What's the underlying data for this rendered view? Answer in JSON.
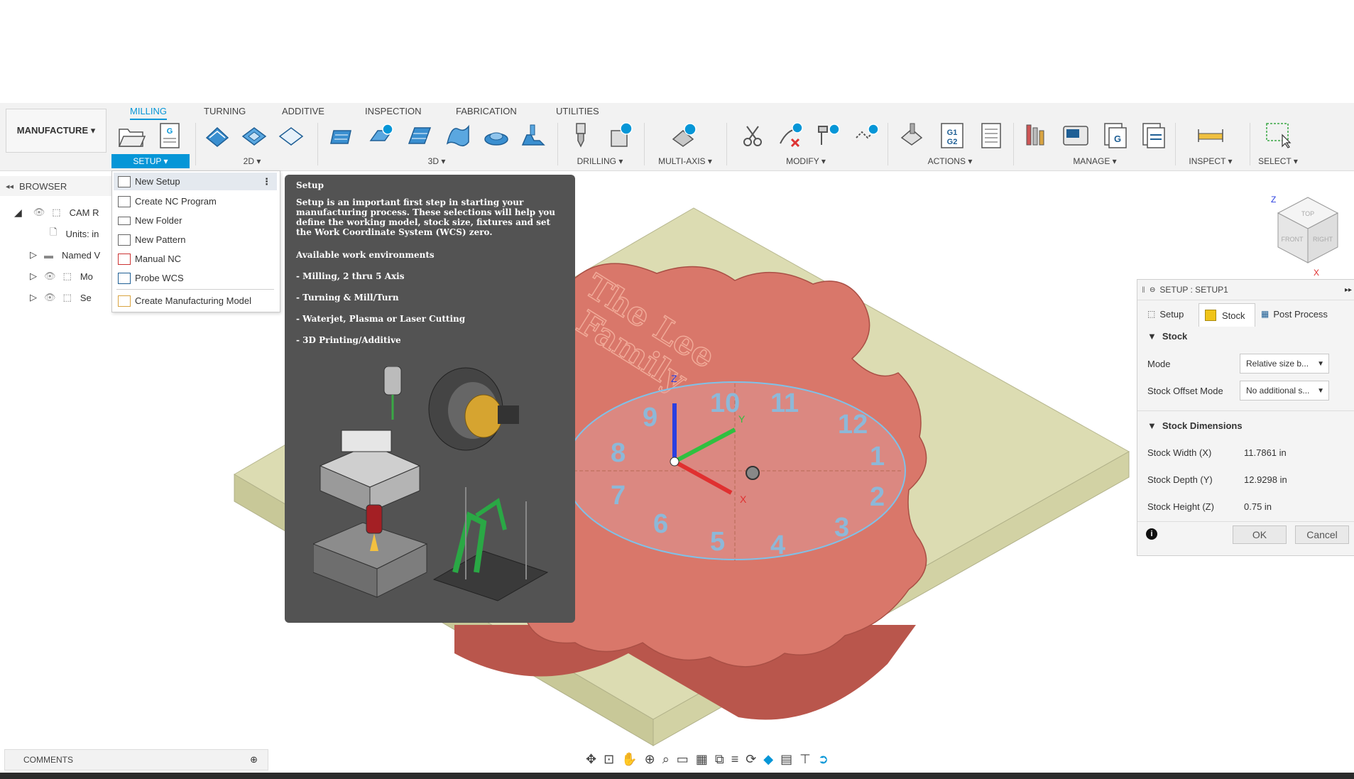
{
  "workspace": {
    "label": "MANUFACTURE ▾"
  },
  "tabs": [
    "MILLING",
    "TURNING",
    "ADDITIVE",
    "INSPECTION",
    "FABRICATION",
    "UTILITIES"
  ],
  "toolbar_groups": {
    "setup": "SETUP ▾",
    "twod": "2D ▾",
    "threed": "3D ▾",
    "drilling": "DRILLING ▾",
    "multiaxis": "MULTI-AXIS ▾",
    "modify": "MODIFY ▾",
    "actions": "ACTIONS ▾",
    "manage": "MANAGE ▾",
    "inspect": "INSPECT ▾",
    "select": "SELECT ▾"
  },
  "browser": {
    "header": "BROWSER",
    "rows": [
      "CAM R",
      "Units: in",
      "Named V",
      "Mo",
      "Se"
    ]
  },
  "setup_menu": {
    "items": [
      "New Setup",
      "Create NC Program",
      "New Folder",
      "New Pattern",
      "Manual NC",
      "Probe WCS",
      "Create Manufacturing Model"
    ]
  },
  "tooltip": {
    "title": "Setup",
    "description": "Setup is an important first step in starting your manufacturing process. These selections will help you define the working model, stock size, fixtures and set the Work Coordinate System (WCS) zero.",
    "environments_heading": "Available work environments",
    "environments": [
      "- Milling, 2 thru 5 Axis",
      "- Turning & Mill/Turn",
      "- Waterjet, Plasma or Laser Cutting",
      "- 3D Printing/Additive"
    ]
  },
  "viewport": {
    "engraving": [
      "The Lee",
      "Family"
    ],
    "clock_numbers": [
      "12",
      "1",
      "2",
      "3",
      "4",
      "5",
      "6",
      "7",
      "8",
      "9",
      "10",
      "11"
    ],
    "axis_labels": {
      "z": "Z",
      "x": "X",
      "y": "Y"
    },
    "viewcube": {
      "top": "TOP",
      "front": "FRONT",
      "right": "RIGHT",
      "z": "Z",
      "x": "X"
    }
  },
  "setup_panel": {
    "title": "SETUP : SETUP1",
    "tabs": [
      "Setup",
      "Stock",
      "Post Process"
    ],
    "stock_section": "Stock",
    "mode_label": "Mode",
    "mode_value": "Relative size b...",
    "offset_mode_label": "Stock Offset Mode",
    "offset_mode_value": "No additional s...",
    "dimensions_section": "Stock Dimensions",
    "width_label": "Stock Width (X)",
    "width_value": "11.7861 in",
    "depth_label": "Stock Depth (Y)",
    "depth_value": "12.9298 in",
    "height_label": "Stock Height (Z)",
    "height_value": "0.75 in",
    "ok_label": "OK",
    "cancel_label": "Cancel"
  },
  "comments": {
    "label": "COMMENTS"
  },
  "colors": {
    "accent": "#0696d7",
    "part": "#d9776a",
    "stock": "#d8d8a8",
    "annotation": "#1a4fd6",
    "tooltip_bg": "#535353"
  }
}
